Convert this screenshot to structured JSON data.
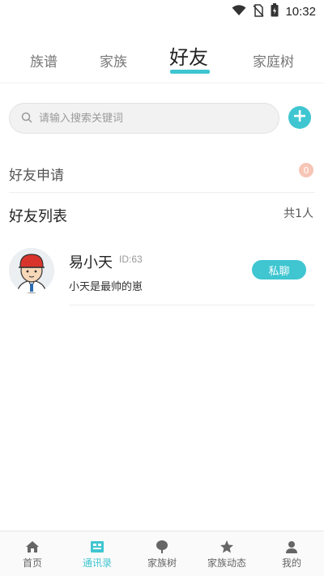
{
  "status_bar": {
    "time": "10:32"
  },
  "tabs": [
    {
      "label": "族谱",
      "active": false
    },
    {
      "label": "家族",
      "active": false
    },
    {
      "label": "好友",
      "active": true
    },
    {
      "label": "家庭树",
      "active": false
    }
  ],
  "search": {
    "placeholder": "请输入搜索关键词",
    "value": ""
  },
  "friend_request": {
    "label": "好友申请",
    "count": "0"
  },
  "friend_list": {
    "title": "好友列表",
    "count_text": "共1人",
    "items": [
      {
        "name": "易小天",
        "id": "ID:63",
        "signature": "小天是最帅的崽",
        "chat_label": "私聊"
      }
    ]
  },
  "bottom_nav": [
    {
      "label": "首页",
      "icon": "home-icon",
      "active": false
    },
    {
      "label": "通讯录",
      "icon": "contacts-icon",
      "active": true
    },
    {
      "label": "家族树",
      "icon": "tree-icon",
      "active": false
    },
    {
      "label": "家族动态",
      "icon": "star-icon",
      "active": false
    },
    {
      "label": "我的",
      "icon": "user-icon",
      "active": false
    }
  ],
  "colors": {
    "accent": "#3fc6d1",
    "badge": "#f7c5b6"
  }
}
